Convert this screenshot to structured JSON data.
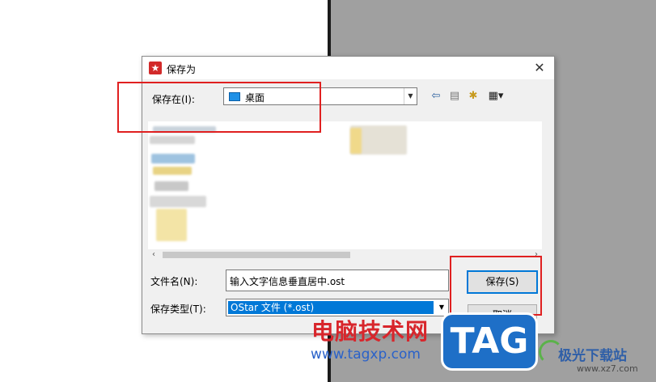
{
  "dialog": {
    "title": "保存为",
    "save_in_label": "保存在(I):",
    "location": "桌面",
    "filename_label": "文件名(N):",
    "filename_value": "输入文字信息垂直居中.ost",
    "filetype_label": "保存类型(T):",
    "filetype_value": "OStar 文件 (*.ost)",
    "save_button": "保存(S)",
    "cancel_button": "取消"
  },
  "toolbar": {
    "icons": [
      "back-icon",
      "up-folder-icon",
      "new-folder-icon",
      "view-menu-icon"
    ]
  },
  "watermark": {
    "site_name": "电脑技术网",
    "site_url": "www.tagxp.com",
    "tag_logo": "TAG",
    "xz_name": "极光下载站",
    "xz_url": "www.xz7.com"
  },
  "colors": {
    "highlight": "#e02020",
    "selection": "#0078d7",
    "app_icon": "#d22a2a"
  }
}
